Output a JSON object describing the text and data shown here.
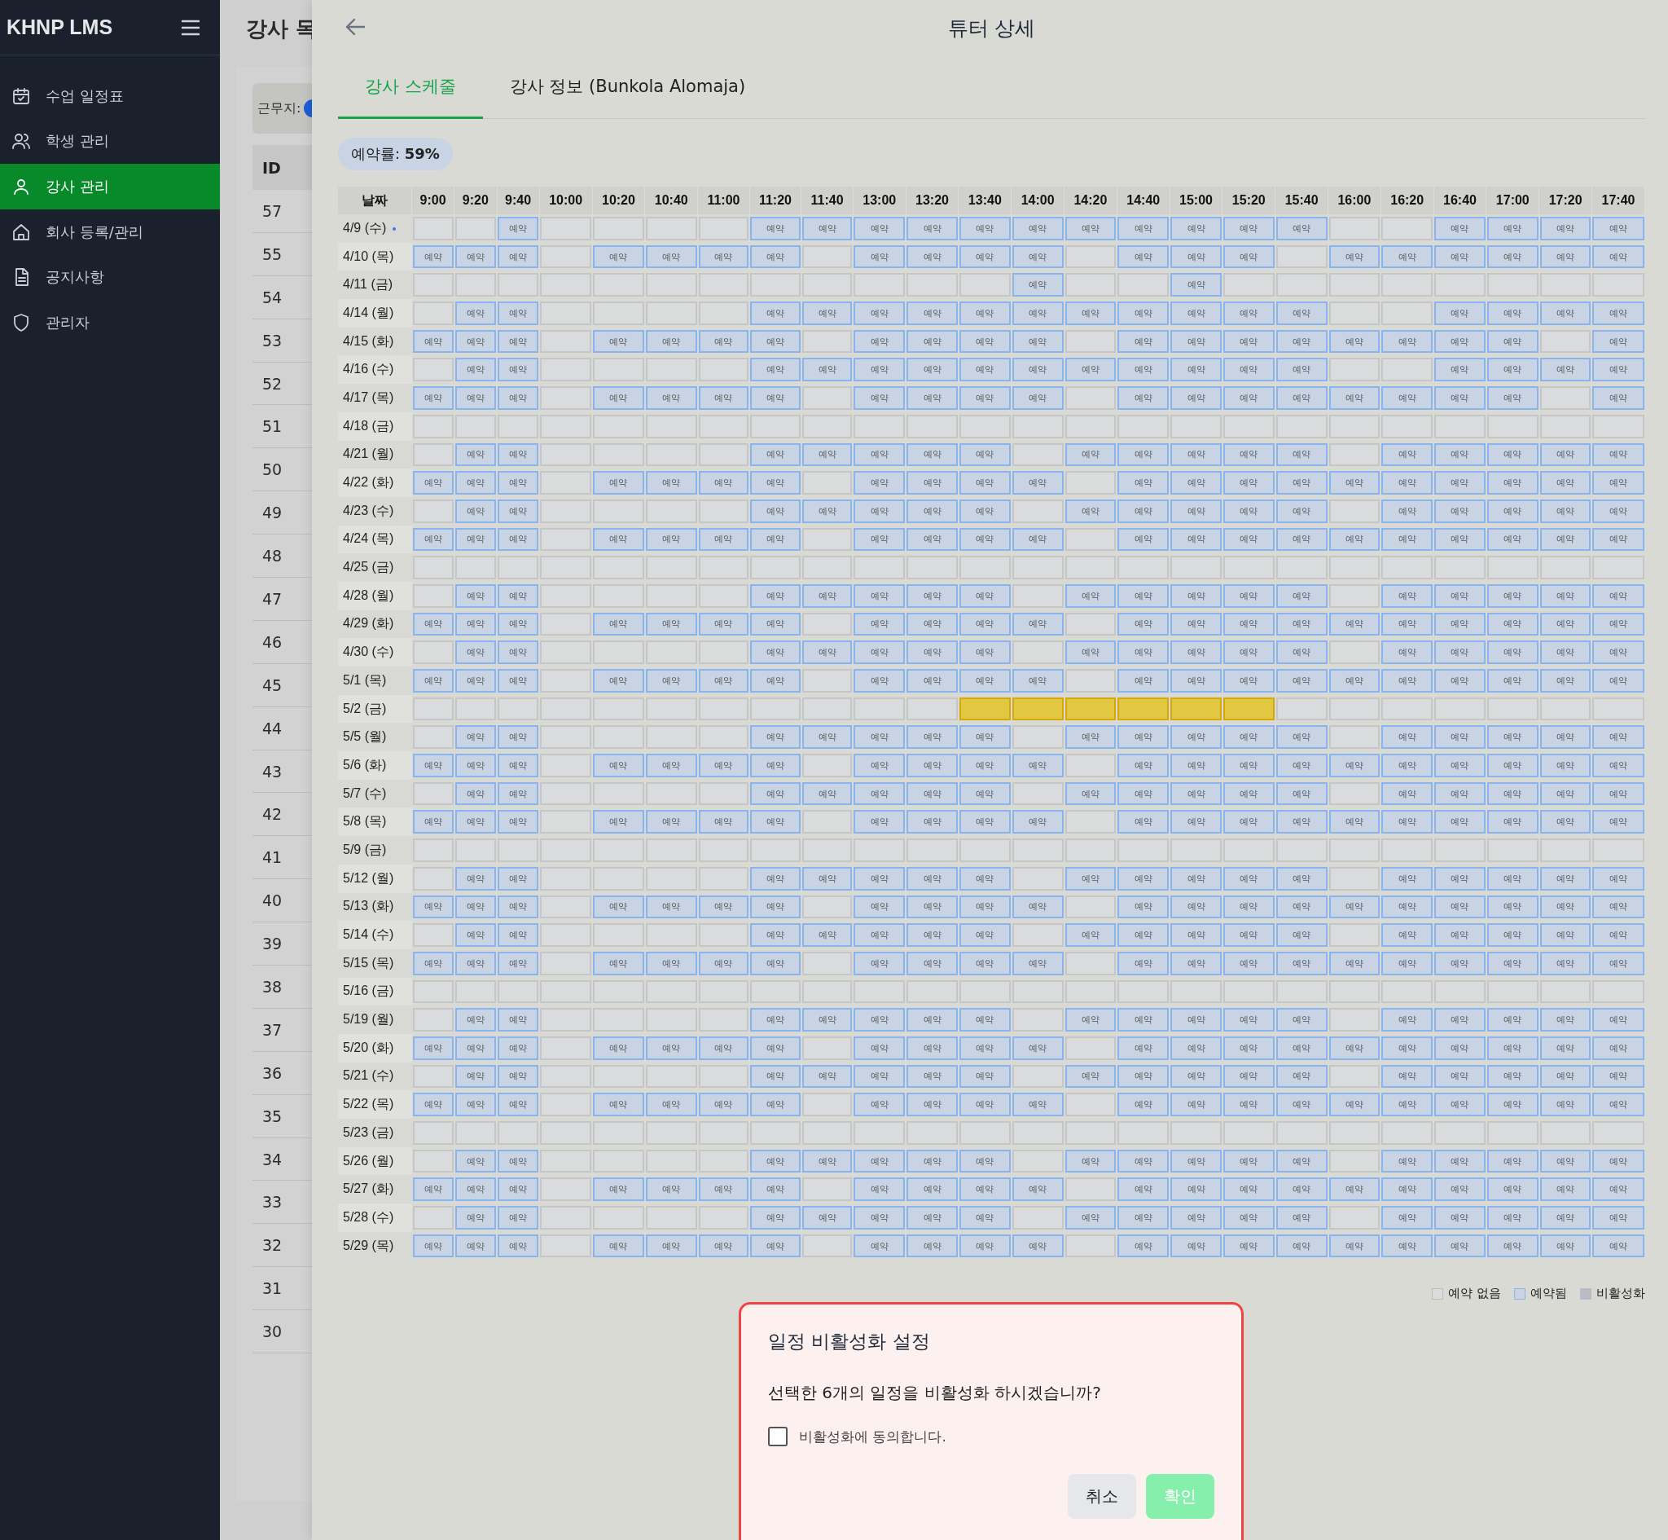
{
  "sidebar": {
    "logo": "KHNP LMS",
    "items": [
      {
        "label": "수업 일정표",
        "selected": false
      },
      {
        "label": "학생 관리",
        "selected": false
      },
      {
        "label": "강사 관리",
        "selected": true
      },
      {
        "label": "회사 등록/관리",
        "selected": false
      },
      {
        "label": "공지사항",
        "selected": false
      },
      {
        "label": "관리자",
        "selected": false
      }
    ]
  },
  "background_page": {
    "title": "강사 목",
    "filter_label": "근무지:",
    "id_column": "ID",
    "ids": [
      "57",
      "55",
      "54",
      "53",
      "52",
      "51",
      "50",
      "49",
      "48",
      "47",
      "46",
      "45",
      "44",
      "43",
      "42",
      "41",
      "40",
      "39",
      "38",
      "37",
      "36",
      "35",
      "34",
      "33",
      "32",
      "31",
      "30"
    ]
  },
  "drawer": {
    "title": "튜터 상세",
    "tabs": [
      {
        "label": "강사 스케줄",
        "selected": true
      },
      {
        "label": "강사 정보 (Bunkola Alomaja)",
        "selected": false
      }
    ],
    "booking_rate": {
      "label": "예약률:",
      "value": "59%"
    },
    "schedule": {
      "date_header": "날짜",
      "columns": [
        "9:00",
        "9:20",
        "9:40",
        "10:00",
        "10:20",
        "10:40",
        "11:00",
        "11:20",
        "11:40",
        "13:00",
        "13:20",
        "13:40",
        "14:00",
        "14:20",
        "14:40",
        "15:00",
        "15:20",
        "15:40",
        "16:00",
        "16:20",
        "16:40",
        "17:00",
        "17:20",
        "17:40"
      ],
      "rows": [
        {
          "date": "4/9 (수)",
          "today": true,
          "cells": [
            "",
            "",
            "예약",
            "",
            "",
            "",
            "",
            "예약",
            "예약",
            "예약",
            "예약",
            "예약",
            "예약",
            "예약",
            "예약",
            "예약",
            "예약",
            "예약",
            "",
            "",
            "예약",
            "예약",
            "예약",
            "예약"
          ]
        },
        {
          "date": "4/10 (목)",
          "today": false,
          "cells": [
            "예약",
            "예약",
            "예약",
            "",
            "예약",
            "예약",
            "예약",
            "예약",
            "",
            "예약",
            "예약",
            "예약",
            "예약",
            "",
            "예약",
            "예약",
            "예약",
            "",
            "예약",
            "예약",
            "예약",
            "예약",
            "예약",
            "예약"
          ]
        },
        {
          "date": "4/11 (금)",
          "today": false,
          "cells": [
            "",
            "",
            "",
            "",
            "",
            "",
            "",
            "",
            "",
            "",
            "",
            "",
            "예약",
            "",
            "",
            "예약",
            "",
            "",
            "",
            "",
            "",
            "",
            "",
            ""
          ]
        },
        {
          "date": "4/14 (월)",
          "today": false,
          "cells": [
            "",
            "예약",
            "예약",
            "",
            "",
            "",
            "",
            "예약",
            "예약",
            "예약",
            "예약",
            "예약",
            "예약",
            "예약",
            "예약",
            "예약",
            "예약",
            "예약",
            "",
            "",
            "예약",
            "예약",
            "예약",
            "예약"
          ]
        },
        {
          "date": "4/15 (화)",
          "today": false,
          "cells": [
            "예약",
            "예약",
            "예약",
            "",
            "예약",
            "예약",
            "예약",
            "예약",
            "",
            "예약",
            "예약",
            "예약",
            "예약",
            "",
            "예약",
            "예약",
            "예약",
            "예약",
            "예약",
            "예약",
            "예약",
            "예약",
            "",
            "예약"
          ]
        },
        {
          "date": "4/16 (수)",
          "today": false,
          "cells": [
            "",
            "예약",
            "예약",
            "",
            "",
            "",
            "",
            "예약",
            "예약",
            "예약",
            "예약",
            "예약",
            "예약",
            "예약",
            "예약",
            "예약",
            "예약",
            "예약",
            "",
            "",
            "예약",
            "예약",
            "예약",
            "예약"
          ]
        },
        {
          "date": "4/17 (목)",
          "today": false,
          "cells": [
            "예약",
            "예약",
            "예약",
            "",
            "예약",
            "예약",
            "예약",
            "예약",
            "",
            "예약",
            "예약",
            "예약",
            "예약",
            "",
            "예약",
            "예약",
            "예약",
            "예약",
            "예약",
            "예약",
            "예약",
            "예약",
            "",
            "예약"
          ]
        },
        {
          "date": "4/18 (금)",
          "today": false,
          "cells": [
            "",
            "",
            "",
            "",
            "",
            "",
            "",
            "",
            "",
            "",
            "",
            "",
            "",
            "",
            "",
            "",
            "",
            "",
            "",
            "",
            "",
            "",
            "",
            ""
          ]
        },
        {
          "date": "4/21 (월)",
          "today": false,
          "cells": [
            "",
            "예약",
            "예약",
            "",
            "",
            "",
            "",
            "예약",
            "예약",
            "예약",
            "예약",
            "예약",
            "",
            "예약",
            "예약",
            "예약",
            "예약",
            "예약",
            "",
            "예약",
            "예약",
            "예약",
            "예약",
            "예약"
          ]
        },
        {
          "date": "4/22 (화)",
          "today": false,
          "cells": [
            "예약",
            "예약",
            "예약",
            "",
            "예약",
            "예약",
            "예약",
            "예약",
            "",
            "예약",
            "예약",
            "예약",
            "예약",
            "",
            "예약",
            "예약",
            "예약",
            "예약",
            "예약",
            "예약",
            "예약",
            "예약",
            "예약",
            "예약"
          ]
        },
        {
          "date": "4/23 (수)",
          "today": false,
          "cells": [
            "",
            "예약",
            "예약",
            "",
            "",
            "",
            "",
            "예약",
            "예약",
            "예약",
            "예약",
            "예약",
            "",
            "예약",
            "예약",
            "예약",
            "예약",
            "예약",
            "",
            "예약",
            "예약",
            "예약",
            "예약",
            "예약"
          ]
        },
        {
          "date": "4/24 (목)",
          "today": false,
          "cells": [
            "예약",
            "예약",
            "예약",
            "",
            "예약",
            "예약",
            "예약",
            "예약",
            "",
            "예약",
            "예약",
            "예약",
            "예약",
            "",
            "예약",
            "예약",
            "예약",
            "예약",
            "예약",
            "예약",
            "예약",
            "예약",
            "예약",
            "예약"
          ]
        },
        {
          "date": "4/25 (금)",
          "today": false,
          "cells": [
            "",
            "",
            "",
            "",
            "",
            "",
            "",
            "",
            "",
            "",
            "",
            "",
            "",
            "",
            "",
            "",
            "",
            "",
            "",
            "",
            "",
            "",
            "",
            ""
          ]
        },
        {
          "date": "4/28 (월)",
          "today": false,
          "cells": [
            "",
            "예약",
            "예약",
            "",
            "",
            "",
            "",
            "예약",
            "예약",
            "예약",
            "예약",
            "예약",
            "",
            "예약",
            "예약",
            "예약",
            "예약",
            "예약",
            "",
            "예약",
            "예약",
            "예약",
            "예약",
            "예약"
          ]
        },
        {
          "date": "4/29 (화)",
          "today": false,
          "cells": [
            "예약",
            "예약",
            "예약",
            "",
            "예약",
            "예약",
            "예약",
            "예약",
            "",
            "예약",
            "예약",
            "예약",
            "예약",
            "",
            "예약",
            "예약",
            "예약",
            "예약",
            "예약",
            "예약",
            "예약",
            "예약",
            "예약",
            "예약"
          ]
        },
        {
          "date": "4/30 (수)",
          "today": false,
          "cells": [
            "",
            "예약",
            "예약",
            "",
            "",
            "",
            "",
            "예약",
            "예약",
            "예약",
            "예약",
            "예약",
            "",
            "예약",
            "예약",
            "예약",
            "예약",
            "예약",
            "",
            "예약",
            "예약",
            "예약",
            "예약",
            "예약"
          ]
        },
        {
          "date": "5/1 (목)",
          "today": false,
          "cells": [
            "예약",
            "예약",
            "예약",
            "",
            "예약",
            "예약",
            "예약",
            "예약",
            "",
            "예약",
            "예약",
            "예약",
            "예약",
            "",
            "예약",
            "예약",
            "예약",
            "예약",
            "예약",
            "예약",
            "예약",
            "예약",
            "예약",
            "예약"
          ]
        },
        {
          "date": "5/2 (금)",
          "today": false,
          "cells": [
            "",
            "",
            "",
            "",
            "",
            "",
            "",
            "",
            "",
            "",
            "",
            {
              "selected": true
            },
            {
              "selected": true
            },
            {
              "selected": true
            },
            {
              "selected": true
            },
            {
              "selected": true
            },
            {
              "selected": true
            },
            "",
            "",
            "",
            "",
            "",
            "",
            ""
          ]
        },
        {
          "date": "5/5 (월)",
          "today": false,
          "cells": [
            "",
            "예약",
            "예약",
            "",
            "",
            "",
            "",
            "예약",
            "예약",
            "예약",
            "예약",
            "예약",
            "",
            "예약",
            "예약",
            "예약",
            "예약",
            "예약",
            "",
            "예약",
            "예약",
            "예약",
            "예약",
            "예약"
          ]
        },
        {
          "date": "5/6 (화)",
          "today": false,
          "cells": [
            "예약",
            "예약",
            "예약",
            "",
            "예약",
            "예약",
            "예약",
            "예약",
            "",
            "예약",
            "예약",
            "예약",
            "예약",
            "",
            "예약",
            "예약",
            "예약",
            "예약",
            "예약",
            "예약",
            "예약",
            "예약",
            "예약",
            "예약"
          ]
        },
        {
          "date": "5/7 (수)",
          "today": false,
          "cells": [
            "",
            "예약",
            "예약",
            "",
            "",
            "",
            "",
            "예약",
            "예약",
            "예약",
            "예약",
            "예약",
            "",
            "예약",
            "예약",
            "예약",
            "예약",
            "예약",
            "",
            "예약",
            "예약",
            "예약",
            "예약",
            "예약"
          ]
        },
        {
          "date": "5/8 (목)",
          "today": false,
          "cells": [
            "예약",
            "예약",
            "예약",
            "",
            "예약",
            "예약",
            "예약",
            "예약",
            "",
            "예약",
            "예약",
            "예약",
            "예약",
            "",
            "예약",
            "예약",
            "예약",
            "예약",
            "예약",
            "예약",
            "예약",
            "예약",
            "예약",
            "예약"
          ]
        },
        {
          "date": "5/9 (금)",
          "today": false,
          "cells": [
            "",
            "",
            "",
            "",
            "",
            "",
            "",
            "",
            "",
            "",
            "",
            "",
            "",
            "",
            "",
            "",
            "",
            "",
            "",
            "",
            "",
            "",
            "",
            ""
          ]
        },
        {
          "date": "5/12 (월)",
          "today": false,
          "cells": [
            "",
            "예약",
            "예약",
            "",
            "",
            "",
            "",
            "예약",
            "예약",
            "예약",
            "예약",
            "예약",
            "",
            "예약",
            "예약",
            "예약",
            "예약",
            "예약",
            "",
            "예약",
            "예약",
            "예약",
            "예약",
            "예약"
          ]
        },
        {
          "date": "5/13 (화)",
          "today": false,
          "cells": [
            "예약",
            "예약",
            "예약",
            "",
            "예약",
            "예약",
            "예약",
            "예약",
            "",
            "예약",
            "예약",
            "예약",
            "예약",
            "",
            "예약",
            "예약",
            "예약",
            "예약",
            "예약",
            "예약",
            "예약",
            "예약",
            "예약",
            "예약"
          ]
        },
        {
          "date": "5/14 (수)",
          "today": false,
          "cells": [
            "",
            "예약",
            "예약",
            "",
            "",
            "",
            "",
            "예약",
            "예약",
            "예약",
            "예약",
            "예약",
            "",
            "예약",
            "예약",
            "예약",
            "예약",
            "예약",
            "",
            "예약",
            "예약",
            "예약",
            "예약",
            "예약"
          ]
        },
        {
          "date": "5/15 (목)",
          "today": false,
          "cells": [
            "예약",
            "예약",
            "예약",
            "",
            "예약",
            "예약",
            "예약",
            "예약",
            "",
            "예약",
            "예약",
            "예약",
            "예약",
            "",
            "예약",
            "예약",
            "예약",
            "예약",
            "예약",
            "예약",
            "예약",
            "예약",
            "예약",
            "예약"
          ]
        },
        {
          "date": "5/16 (금)",
          "today": false,
          "cells": [
            "",
            "",
            "",
            "",
            "",
            "",
            "",
            "",
            "",
            "",
            "",
            "",
            "",
            "",
            "",
            "",
            "",
            "",
            "",
            "",
            "",
            "",
            "",
            ""
          ]
        },
        {
          "date": "5/19 (월)",
          "today": false,
          "cells": [
            "",
            "예약",
            "예약",
            "",
            "",
            "",
            "",
            "예약",
            "예약",
            "예약",
            "예약",
            "예약",
            "",
            "예약",
            "예약",
            "예약",
            "예약",
            "예약",
            "",
            "예약",
            "예약",
            "예약",
            "예약",
            "예약"
          ]
        },
        {
          "date": "5/20 (화)",
          "today": false,
          "cells": [
            "예약",
            "예약",
            "예약",
            "",
            "예약",
            "예약",
            "예약",
            "예약",
            "",
            "예약",
            "예약",
            "예약",
            "예약",
            "",
            "예약",
            "예약",
            "예약",
            "예약",
            "예약",
            "예약",
            "예약",
            "예약",
            "예약",
            "예약"
          ]
        },
        {
          "date": "5/21 (수)",
          "today": false,
          "cells": [
            "",
            "예약",
            "예약",
            "",
            "",
            "",
            "",
            "예약",
            "예약",
            "예약",
            "예약",
            "예약",
            "",
            "예약",
            "예약",
            "예약",
            "예약",
            "예약",
            "",
            "예약",
            "예약",
            "예약",
            "예약",
            "예약"
          ]
        },
        {
          "date": "5/22 (목)",
          "today": false,
          "cells": [
            "예약",
            "예약",
            "예약",
            "",
            "예약",
            "예약",
            "예약",
            "예약",
            "",
            "예약",
            "예약",
            "예약",
            "예약",
            "",
            "예약",
            "예약",
            "예약",
            "예약",
            "예약",
            "예약",
            "예약",
            "예약",
            "예약",
            "예약"
          ]
        },
        {
          "date": "5/23 (금)",
          "today": false,
          "cells": [
            "",
            "",
            "",
            "",
            "",
            "",
            "",
            "",
            "",
            "",
            "",
            "",
            "",
            "",
            "",
            "",
            "",
            "",
            "",
            "",
            "",
            "",
            "",
            ""
          ]
        },
        {
          "date": "5/26 (월)",
          "today": false,
          "cells": [
            "",
            "예약",
            "예약",
            "",
            "",
            "",
            "",
            "예약",
            "예약",
            "예약",
            "예약",
            "예약",
            "",
            "예약",
            "예약",
            "예약",
            "예약",
            "예약",
            "",
            "예약",
            "예약",
            "예약",
            "예약",
            "예약"
          ]
        },
        {
          "date": "5/27 (화)",
          "today": false,
          "cells": [
            "예약",
            "예약",
            "예약",
            "",
            "예약",
            "예약",
            "예약",
            "예약",
            "",
            "예약",
            "예약",
            "예약",
            "예약",
            "",
            "예약",
            "예약",
            "예약",
            "예약",
            "예약",
            "예약",
            "예약",
            "예약",
            "예약",
            "예약"
          ]
        },
        {
          "date": "5/28 (수)",
          "today": false,
          "cells": [
            "",
            "예약",
            "예약",
            "",
            "",
            "",
            "",
            "예약",
            "예약",
            "예약",
            "예약",
            "예약",
            "",
            "예약",
            "예약",
            "예약",
            "예약",
            "예약",
            "",
            "예약",
            "예약",
            "예약",
            "예약",
            "예약"
          ]
        },
        {
          "date": "5/29 (목)",
          "today": false,
          "cells": [
            "예약",
            "예약",
            "예약",
            "",
            "예약",
            "예약",
            "예약",
            "예약",
            "",
            "예약",
            "예약",
            "예약",
            "예약",
            "",
            "예약",
            "예약",
            "예약",
            "예약",
            "예약",
            "예약",
            "예약",
            "예약",
            "예약",
            "예약"
          ]
        }
      ]
    },
    "legend": [
      {
        "label": "예약 없음",
        "kind": "empty"
      },
      {
        "label": "예약됨",
        "kind": "booked"
      },
      {
        "label": "비활성화",
        "kind": "disabled"
      }
    ]
  },
  "dialog": {
    "title": "일정 비활성화 설정",
    "message": "선택한 6개의 일정을 비활성화 하시겠습니까?",
    "checkbox": {
      "label": "비활성화에 동의합니다.",
      "checked": false
    },
    "buttons": [
      {
        "label": "취소",
        "kind": "cancel",
        "disabled": false
      },
      {
        "label": "확인",
        "kind": "confirm",
        "disabled": true
      }
    ]
  }
}
